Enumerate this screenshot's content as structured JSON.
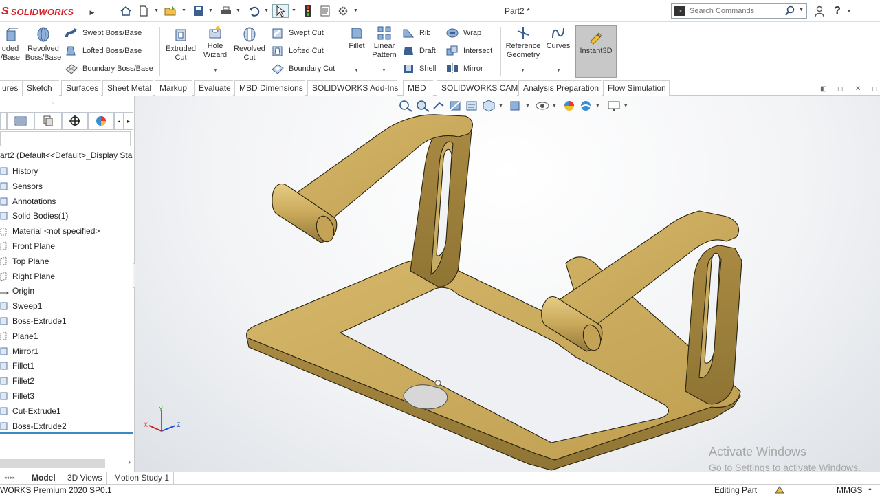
{
  "app": {
    "logo_ds": "S",
    "logo_word": "SOLIDWORKS",
    "document_title": "Part2 *"
  },
  "search": {
    "placeholder": "Search Commands"
  },
  "toolbar": {
    "extruded_boss_label_l1": "uded",
    "extruded_boss_label_l2": "/Base",
    "revolved_boss_l1": "Revolved",
    "revolved_boss_l2": "Boss/Base",
    "swept_boss": "Swept Boss/Base",
    "lofted_boss": "Lofted Boss/Base",
    "boundary_boss": "Boundary Boss/Base",
    "extruded_cut_l1": "Extruded",
    "extruded_cut_l2": "Cut",
    "hole_wizard_l1": "Hole",
    "hole_wizard_l2": "Wizard",
    "revolved_cut_l1": "Revolved",
    "revolved_cut_l2": "Cut",
    "swept_cut": "Swept Cut",
    "lofted_cut": "Lofted Cut",
    "boundary_cut": "Boundary Cut",
    "fillet": "Fillet",
    "linear_pattern_l1": "Linear",
    "linear_pattern_l2": "Pattern",
    "rib": "Rib",
    "draft": "Draft",
    "shell": "Shell",
    "wrap": "Wrap",
    "intersect": "Intersect",
    "mirror": "Mirror",
    "reference_geometry_l1": "Reference",
    "reference_geometry_l2": "Geometry",
    "curves": "Curves",
    "instant3d": "Instant3D"
  },
  "tabs": [
    "ures",
    "Sketch",
    "Surfaces",
    "Sheet Metal",
    "Markup",
    "Evaluate",
    "MBD Dimensions",
    "SOLIDWORKS Add-Ins",
    "MBD",
    "SOLIDWORKS CAM",
    "Analysis Preparation",
    "Flow Simulation"
  ],
  "feature_tree": {
    "root": "art2  (Default<<Default>_Display Sta",
    "items": [
      {
        "label": "History",
        "icon": "history-icon"
      },
      {
        "label": "Sensors",
        "icon": "sensors-icon"
      },
      {
        "label": "Annotations",
        "icon": "annotations-icon"
      },
      {
        "label": "Solid Bodies(1)",
        "icon": "solid-bodies-icon"
      },
      {
        "label": "Material <not specified>",
        "icon": "material-icon"
      },
      {
        "label": "Front Plane",
        "icon": "plane-icon"
      },
      {
        "label": "Top Plane",
        "icon": "plane-icon"
      },
      {
        "label": "Right Plane",
        "icon": "plane-icon"
      },
      {
        "label": "Origin",
        "icon": "origin-icon"
      },
      {
        "label": "Sweep1",
        "icon": "sweep-icon"
      },
      {
        "label": "Boss-Extrude1",
        "icon": "extrude-icon"
      },
      {
        "label": "Plane1",
        "icon": "plane-icon"
      },
      {
        "label": "Mirror1",
        "icon": "mirror-icon"
      },
      {
        "label": "Fillet1",
        "icon": "fillet-icon"
      },
      {
        "label": "Fillet2",
        "icon": "fillet-icon"
      },
      {
        "label": "Fillet3",
        "icon": "fillet-icon"
      },
      {
        "label": "Cut-Extrude1",
        "icon": "cut-extrude-icon"
      },
      {
        "label": "Boss-Extrude2",
        "icon": "extrude-icon"
      }
    ]
  },
  "viewport": {
    "watermark_line1": "Activate Windows",
    "watermark_line2": "Go to Settings to activate Windows.",
    "triad_x": "X",
    "triad_y": "Y",
    "triad_z": "Z",
    "model_color": "#c9a95a"
  },
  "bottom_tabs": [
    "Model",
    "3D Views",
    "Motion Study 1"
  ],
  "status": {
    "product": "WORKS Premium 2020 SP0.1",
    "mode": "Editing Part",
    "units": "MMGS"
  }
}
